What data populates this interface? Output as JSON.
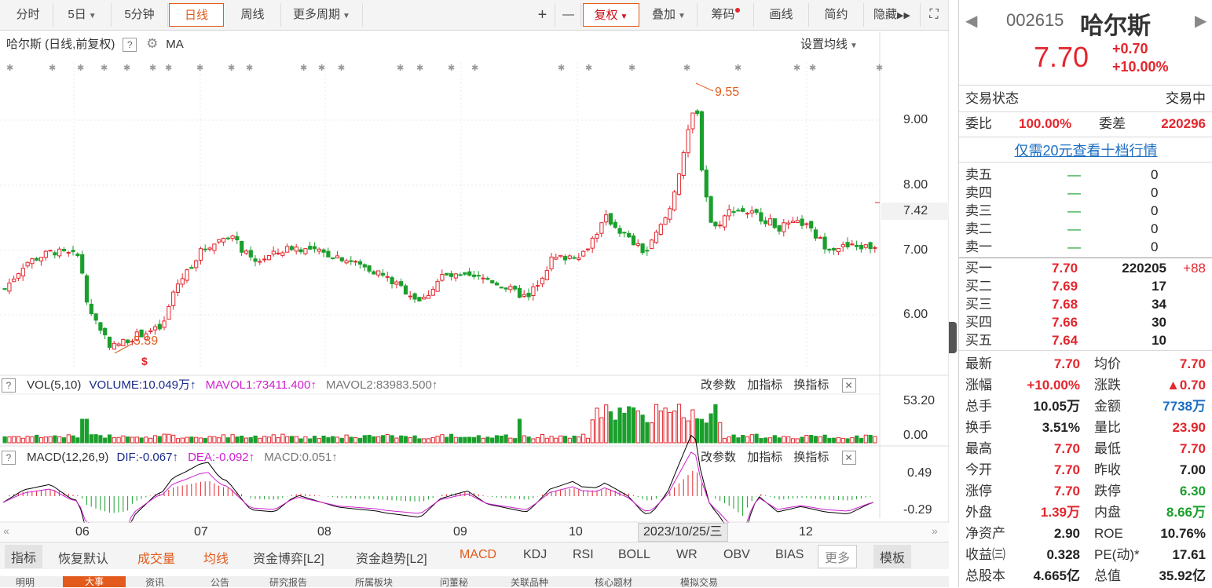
{
  "toolbar": {
    "periods": [
      "分时",
      "5日",
      "5分钟",
      "日线",
      "周线",
      "更多周期"
    ],
    "active_period": "日线",
    "buttons": [
      "+",
      "—",
      "复权",
      "叠加",
      "筹码",
      "画线",
      "简约",
      "隐藏"
    ]
  },
  "chart_header": {
    "title": "哈尔斯 (日线,前复权)",
    "ma_label": "MA",
    "set_ma": "设置均线"
  },
  "chart_data": {
    "type": "candlestick",
    "y_ticks": [
      "9.00",
      "8.00",
      "7.00",
      "6.00"
    ],
    "current_price_tag": "7.42",
    "x_labels": [
      "06",
      "07",
      "08",
      "09",
      "10",
      "12"
    ],
    "high_annotation": "9.55",
    "low_annotation": "5.39",
    "crosshair_date": "2023/10/25/三",
    "ylim": [
      5.3,
      9.7
    ]
  },
  "volume_panel": {
    "name": "VOL(5,10)",
    "volume": "VOLUME:10.049万",
    "mavol1": "MAVOL1:73411.400",
    "mavol2": "MAVOL2:83983.500",
    "ticks": [
      "53.20",
      "0.00"
    ],
    "actions": [
      "改参数",
      "加指标",
      "换指标"
    ]
  },
  "macd_panel": {
    "name": "MACD(12,26,9)",
    "dif": "DIF:-0.067",
    "dea": "DEA:-0.092",
    "macd": "MACD:0.051",
    "ticks": [
      "0.49",
      "-0.29"
    ],
    "actions": [
      "改参数",
      "加指标",
      "换指标"
    ]
  },
  "indicator_tabs": [
    "指标",
    "恢复默认",
    "成交量",
    "均线",
    "资金博弈[L2]",
    "资金趋势[L2]",
    "MACD",
    "KDJ",
    "RSI",
    "BOLL",
    "WR",
    "OBV",
    "BIAS",
    "更多",
    "模板"
  ],
  "bottom_tabs": [
    "明明",
    "大事",
    "资讯",
    "公告",
    "研究报告",
    "所属板块",
    "问董秘",
    "关联品种",
    "核心题材",
    "模拟交易"
  ],
  "quote": {
    "code": "002615",
    "name": "哈尔斯",
    "price": "7.70",
    "change": "+0.70",
    "change_pct": "+10.00%",
    "status_label": "交易状态",
    "status_value": "交易中",
    "weibi_label": "委比",
    "weibi_value": "100.00%",
    "weicha_label": "委差",
    "weicha_value": "220296",
    "promo": "仅需20元查看十档行情",
    "asks": [
      {
        "label": "卖五",
        "price": "—",
        "vol": "0"
      },
      {
        "label": "卖四",
        "price": "—",
        "vol": "0"
      },
      {
        "label": "卖三",
        "price": "—",
        "vol": "0"
      },
      {
        "label": "卖二",
        "price": "—",
        "vol": "0"
      },
      {
        "label": "卖一",
        "price": "—",
        "vol": "0"
      }
    ],
    "bids": [
      {
        "label": "买一",
        "price": "7.70",
        "vol": "220205",
        "extra": "+88"
      },
      {
        "label": "买二",
        "price": "7.69",
        "vol": "17",
        "extra": ""
      },
      {
        "label": "买三",
        "price": "7.68",
        "vol": "34",
        "extra": ""
      },
      {
        "label": "买四",
        "price": "7.66",
        "vol": "30",
        "extra": ""
      },
      {
        "label": "买五",
        "price": "7.64",
        "vol": "10",
        "extra": ""
      }
    ],
    "stats": [
      {
        "l1": "最新",
        "v1": "7.70",
        "c1": "red",
        "l2": "均价",
        "v2": "7.70",
        "c2": "red"
      },
      {
        "l1": "涨幅",
        "v1": "+10.00%",
        "c1": "red",
        "l2": "涨跌",
        "v2": "▲0.70",
        "c2": "red"
      },
      {
        "l1": "总手",
        "v1": "10.05万",
        "c1": "dk",
        "l2": "金额",
        "v2": "7738万",
        "c2": "blu"
      },
      {
        "l1": "换手",
        "v1": "3.51%",
        "c1": "dk",
        "l2": "量比",
        "v2": "23.90",
        "c2": "red"
      },
      {
        "l1": "最高",
        "v1": "7.70",
        "c1": "red",
        "l2": "最低",
        "v2": "7.70",
        "c2": "red"
      },
      {
        "l1": "今开",
        "v1": "7.70",
        "c1": "red",
        "l2": "昨收",
        "v2": "7.00",
        "c2": "dk"
      },
      {
        "l1": "涨停",
        "v1": "7.70",
        "c1": "red",
        "l2": "跌停",
        "v2": "6.30",
        "c2": "grn"
      },
      {
        "l1": "外盘",
        "v1": "1.39万",
        "c1": "red",
        "l2": "内盘",
        "v2": "8.66万",
        "c2": "grn"
      },
      {
        "l1": "净资产",
        "v1": "2.90",
        "c1": "dk",
        "l2": "ROE",
        "v2": "10.76%",
        "c2": "dk"
      },
      {
        "l1": "收益㈢",
        "v1": "0.328",
        "c1": "dk",
        "l2": "PE(动)*",
        "v2": "17.61",
        "c2": "dk"
      },
      {
        "l1": "总股本",
        "v1": "4.665亿",
        "c1": "dk",
        "l2": "总值",
        "v2": "35.92亿",
        "c2": "dk"
      }
    ]
  },
  "colors": {
    "up": "#e3262d",
    "down": "#1a9f2c",
    "accent": "#e25b1c"
  }
}
